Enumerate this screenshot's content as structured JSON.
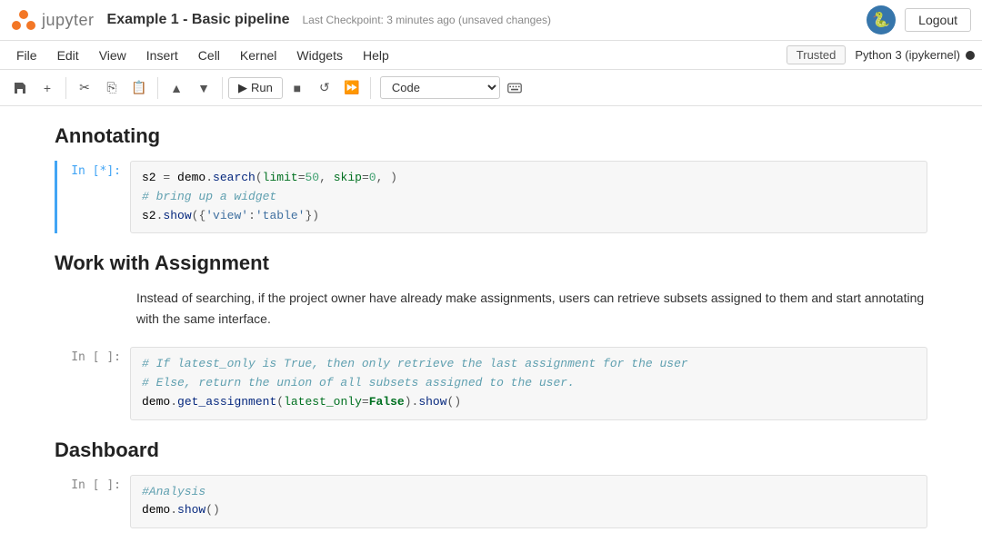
{
  "header": {
    "logo_text": "jupyter",
    "title": "Example 1 - Basic pipeline",
    "checkpoint": "Last Checkpoint: 3 minutes ago",
    "unsaved": "(unsaved changes)",
    "logout_label": "Logout",
    "python_icon": "🐍"
  },
  "menu": {
    "items": [
      "File",
      "Edit",
      "View",
      "Insert",
      "Cell",
      "Kernel",
      "Widgets",
      "Help"
    ],
    "trusted_label": "Trusted",
    "kernel_label": "Python 3 (ipykernel)"
  },
  "toolbar": {
    "run_label": "Run",
    "cell_type": "Code",
    "buttons": [
      "save",
      "add",
      "cut",
      "copy",
      "paste",
      "move-up",
      "move-down",
      "run",
      "stop",
      "restart",
      "restart-run",
      "keyboard"
    ]
  },
  "notebook": {
    "sections": [
      {
        "type": "heading",
        "text": "Annotating"
      },
      {
        "type": "code",
        "label": "In [*]:",
        "active": true,
        "lines": [
          "s2 = demo.search(limit=50, skip=0, )",
          "# bring up a widget",
          "s2.show({'view':'table'})"
        ]
      },
      {
        "type": "heading",
        "text": "Work with Assignment"
      },
      {
        "type": "text",
        "content": "Instead of searching, if the project owner have already make assignments, users can retrieve subsets assigned to them and start annotating with the same interface."
      },
      {
        "type": "code",
        "label": "In [ ]:",
        "active": false,
        "lines": [
          "# If latest_only is True, then only retrieve the last assignment for the user",
          "# Else, return the union of all subsets assigned to the user.",
          "demo.get_assignment(latest_only=False).show()"
        ]
      },
      {
        "type": "heading",
        "text": "Dashboard"
      },
      {
        "type": "code",
        "label": "In [ ]:",
        "active": false,
        "lines": [
          "#Analysis",
          "demo.show()"
        ]
      }
    ]
  }
}
